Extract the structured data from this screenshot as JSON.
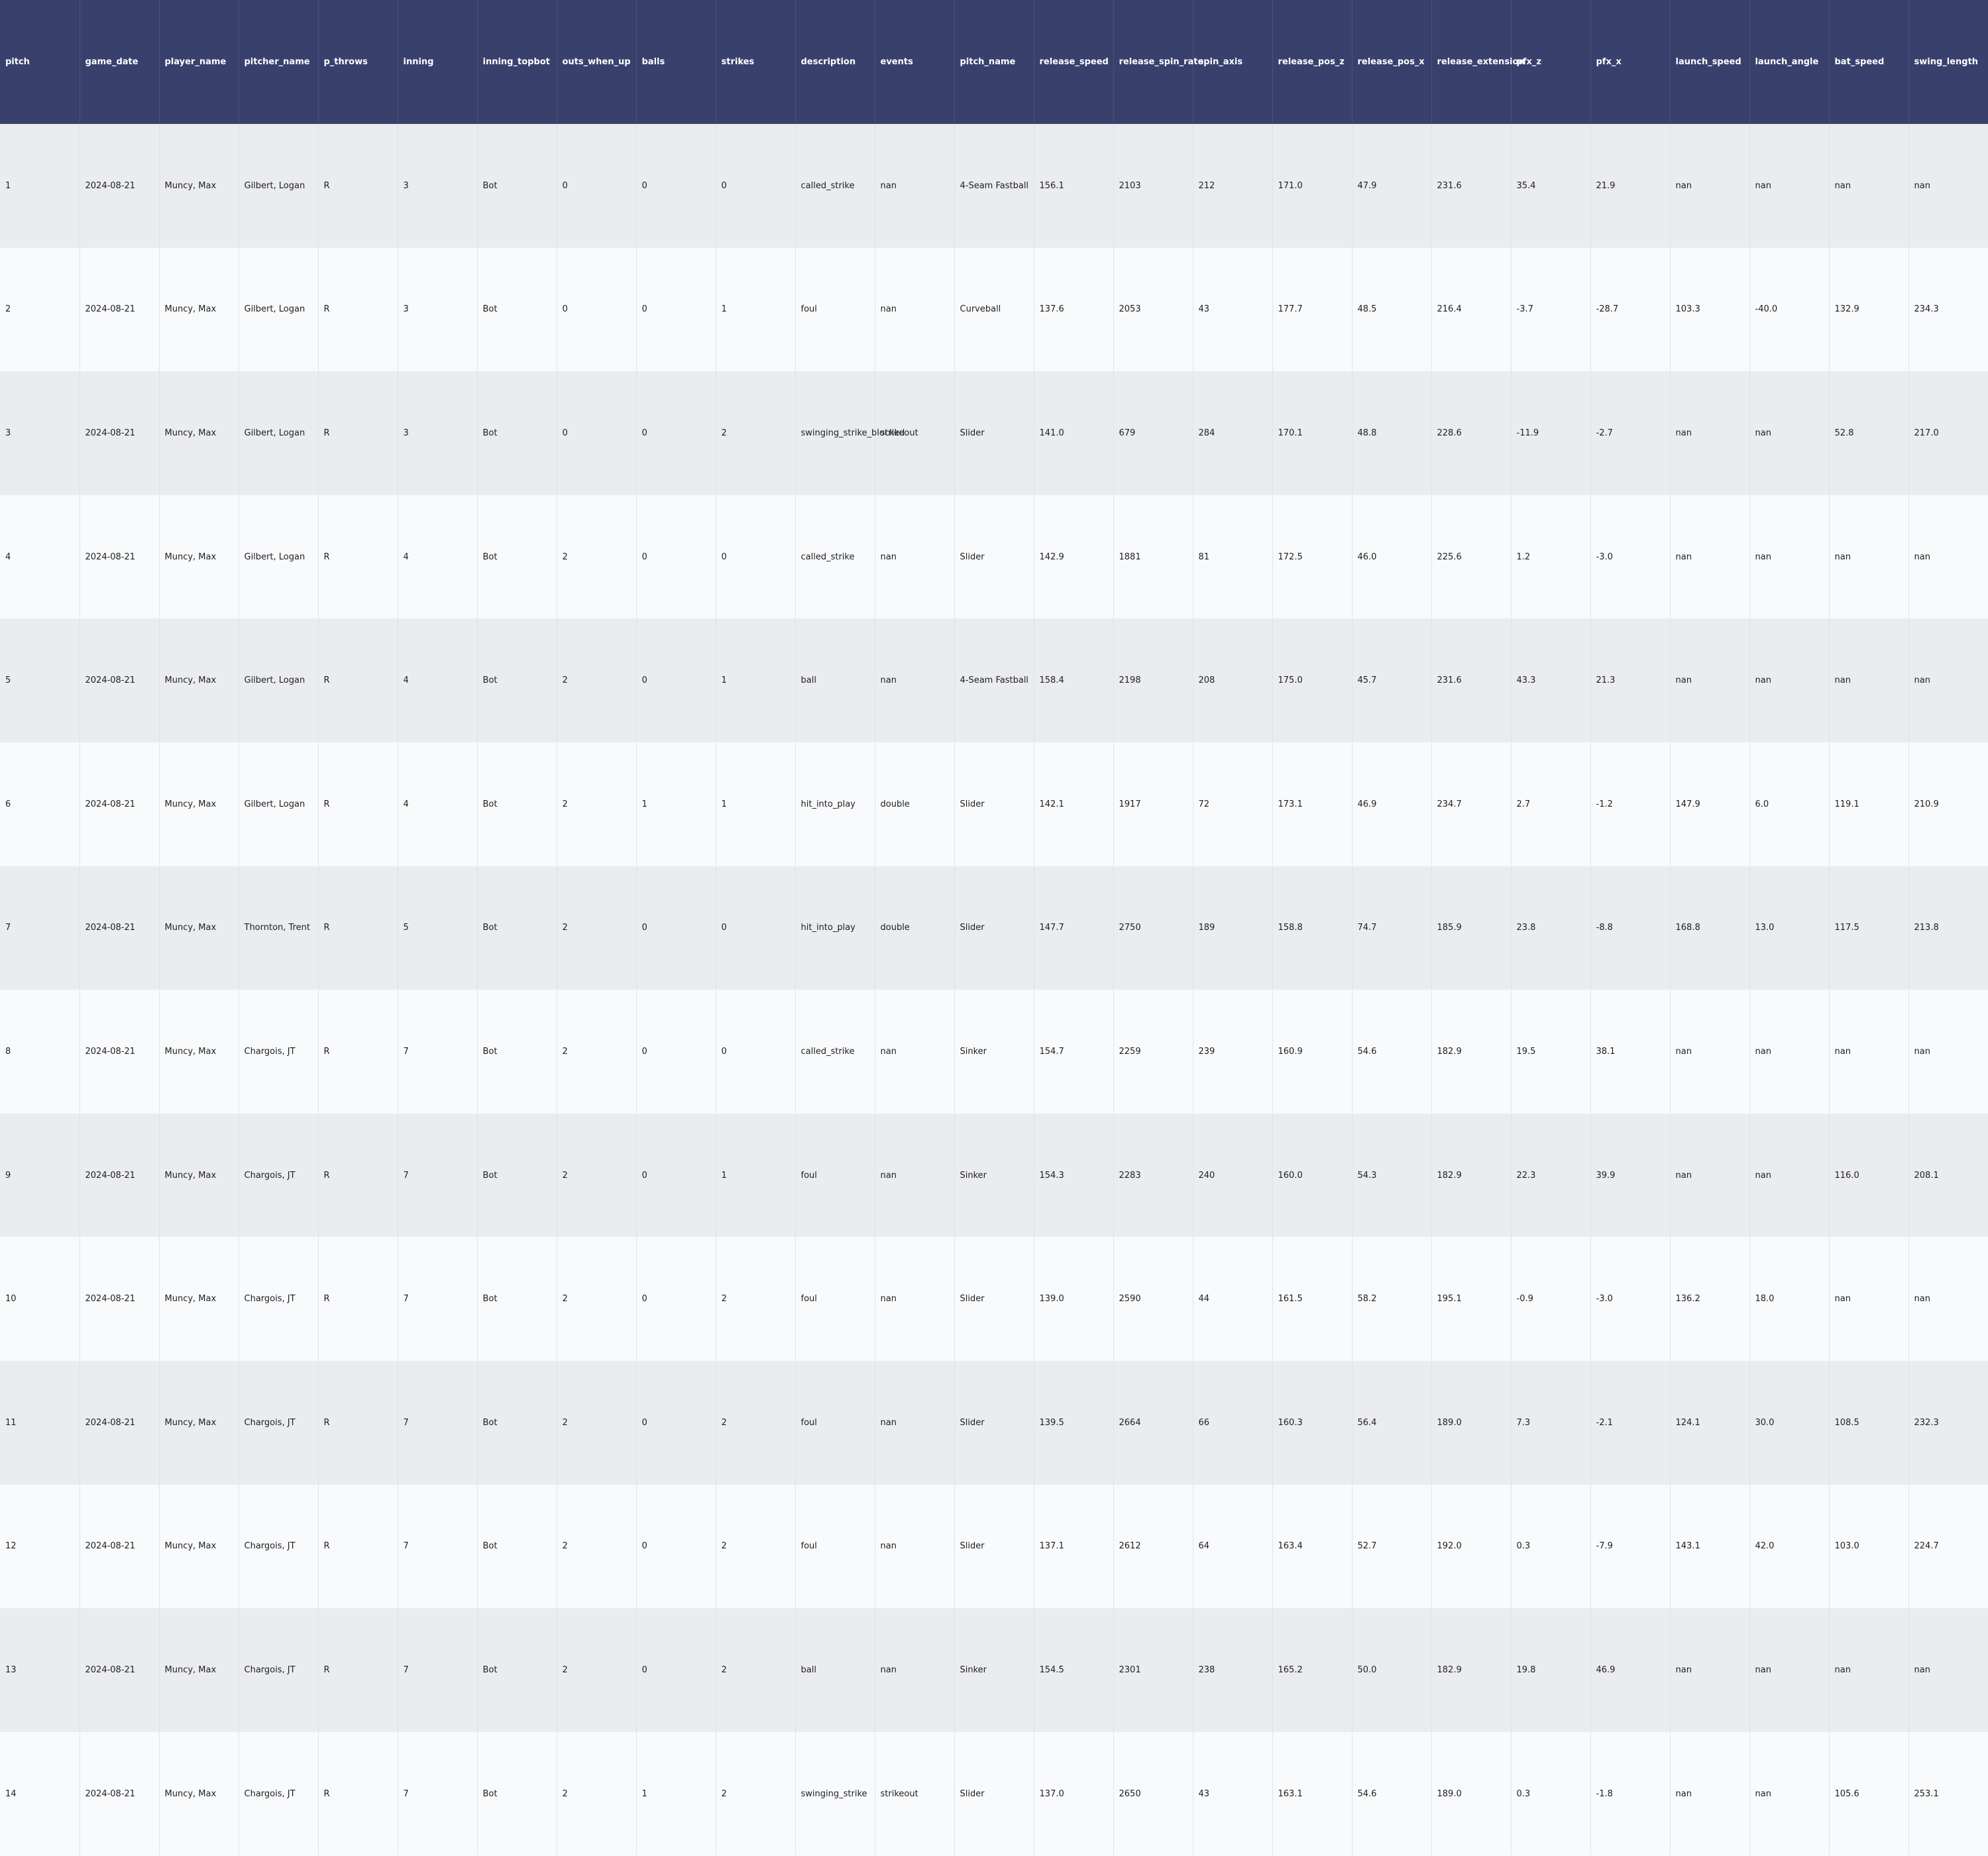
{
  "columns": [
    "pitch",
    "game_date",
    "player_name",
    "pitcher_name",
    "p_throws",
    "inning",
    "inning_topbot",
    "outs_when_up",
    "balls",
    "strikes",
    "description",
    "events",
    "pitch_name",
    "release_speed",
    "release_spin_rate",
    "spin_axis",
    "release_pos_z",
    "release_pos_x",
    "release_extension",
    "pfx_z",
    "pfx_x",
    "launch_speed",
    "launch_angle",
    "bat_speed",
    "swing_length"
  ],
  "rows": [
    [
      "1",
      "2024-08-21",
      "Muncy, Max",
      "Gilbert, Logan",
      "R",
      "3",
      "Bot",
      "0",
      "0",
      "0",
      "called_strike",
      "nan",
      "4-Seam Fastball",
      "156.1",
      "2103",
      "212",
      "171.0",
      "47.9",
      "231.6",
      "35.4",
      "21.9",
      "nan",
      "nan",
      "nan",
      "nan"
    ],
    [
      "2",
      "2024-08-21",
      "Muncy, Max",
      "Gilbert, Logan",
      "R",
      "3",
      "Bot",
      "0",
      "0",
      "1",
      "foul",
      "nan",
      "Curveball",
      "137.6",
      "2053",
      "43",
      "177.7",
      "48.5",
      "216.4",
      "-3.7",
      "-28.7",
      "103.3",
      "-40.0",
      "132.9",
      "234.3"
    ],
    [
      "3",
      "2024-08-21",
      "Muncy, Max",
      "Gilbert, Logan",
      "R",
      "3",
      "Bot",
      "0",
      "0",
      "2",
      "swinging_strike_blocked",
      "strikeout",
      "Slider",
      "141.0",
      "679",
      "284",
      "170.1",
      "48.8",
      "228.6",
      "-11.9",
      "-2.7",
      "nan",
      "nan",
      "52.8",
      "217.0"
    ],
    [
      "4",
      "2024-08-21",
      "Muncy, Max",
      "Gilbert, Logan",
      "R",
      "4",
      "Bot",
      "2",
      "0",
      "0",
      "called_strike",
      "nan",
      "Slider",
      "142.9",
      "1881",
      "81",
      "172.5",
      "46.0",
      "225.6",
      "1.2",
      "-3.0",
      "nan",
      "nan",
      "nan",
      "nan"
    ],
    [
      "5",
      "2024-08-21",
      "Muncy, Max",
      "Gilbert, Logan",
      "R",
      "4",
      "Bot",
      "2",
      "0",
      "1",
      "ball",
      "nan",
      "4-Seam Fastball",
      "158.4",
      "2198",
      "208",
      "175.0",
      "45.7",
      "231.6",
      "43.3",
      "21.3",
      "nan",
      "nan",
      "nan",
      "nan"
    ],
    [
      "6",
      "2024-08-21",
      "Muncy, Max",
      "Gilbert, Logan",
      "R",
      "4",
      "Bot",
      "2",
      "1",
      "1",
      "hit_into_play",
      "double",
      "Slider",
      "142.1",
      "1917",
      "72",
      "173.1",
      "46.9",
      "234.7",
      "2.7",
      "-1.2",
      "147.9",
      "6.0",
      "119.1",
      "210.9"
    ],
    [
      "7",
      "2024-08-21",
      "Muncy, Max",
      "Thornton, Trent",
      "R",
      "5",
      "Bot",
      "2",
      "0",
      "0",
      "hit_into_play",
      "double",
      "Slider",
      "147.7",
      "2750",
      "189",
      "158.8",
      "74.7",
      "185.9",
      "23.8",
      "-8.8",
      "168.8",
      "13.0",
      "117.5",
      "213.8"
    ],
    [
      "8",
      "2024-08-21",
      "Muncy, Max",
      "Chargois, JT",
      "R",
      "7",
      "Bot",
      "2",
      "0",
      "0",
      "called_strike",
      "nan",
      "Sinker",
      "154.7",
      "2259",
      "239",
      "160.9",
      "54.6",
      "182.9",
      "19.5",
      "38.1",
      "nan",
      "nan",
      "nan",
      "nan"
    ],
    [
      "9",
      "2024-08-21",
      "Muncy, Max",
      "Chargois, JT",
      "R",
      "7",
      "Bot",
      "2",
      "0",
      "1",
      "foul",
      "nan",
      "Sinker",
      "154.3",
      "2283",
      "240",
      "160.0",
      "54.3",
      "182.9",
      "22.3",
      "39.9",
      "nan",
      "nan",
      "116.0",
      "208.1"
    ],
    [
      "10",
      "2024-08-21",
      "Muncy, Max",
      "Chargois, JT",
      "R",
      "7",
      "Bot",
      "2",
      "0",
      "2",
      "foul",
      "nan",
      "Slider",
      "139.0",
      "2590",
      "44",
      "161.5",
      "58.2",
      "195.1",
      "-0.9",
      "-3.0",
      "136.2",
      "18.0",
      "nan",
      "nan"
    ],
    [
      "11",
      "2024-08-21",
      "Muncy, Max",
      "Chargois, JT",
      "R",
      "7",
      "Bot",
      "2",
      "0",
      "2",
      "foul",
      "nan",
      "Slider",
      "139.5",
      "2664",
      "66",
      "160.3",
      "56.4",
      "189.0",
      "7.3",
      "-2.1",
      "124.1",
      "30.0",
      "108.5",
      "232.3"
    ],
    [
      "12",
      "2024-08-21",
      "Muncy, Max",
      "Chargois, JT",
      "R",
      "7",
      "Bot",
      "2",
      "0",
      "2",
      "foul",
      "nan",
      "Slider",
      "137.1",
      "2612",
      "64",
      "163.4",
      "52.7",
      "192.0",
      "0.3",
      "-7.9",
      "143.1",
      "42.0",
      "103.0",
      "224.7"
    ],
    [
      "13",
      "2024-08-21",
      "Muncy, Max",
      "Chargois, JT",
      "R",
      "7",
      "Bot",
      "2",
      "0",
      "2",
      "ball",
      "nan",
      "Sinker",
      "154.5",
      "2301",
      "238",
      "165.2",
      "50.0",
      "182.9",
      "19.8",
      "46.9",
      "nan",
      "nan",
      "nan",
      "nan"
    ],
    [
      "14",
      "2024-08-21",
      "Muncy, Max",
      "Chargois, JT",
      "R",
      "7",
      "Bot",
      "2",
      "1",
      "2",
      "swinging_strike",
      "strikeout",
      "Slider",
      "137.0",
      "2650",
      "43",
      "163.1",
      "54.6",
      "189.0",
      "0.3",
      "-1.8",
      "nan",
      "nan",
      "105.6",
      "253.1"
    ]
  ]
}
